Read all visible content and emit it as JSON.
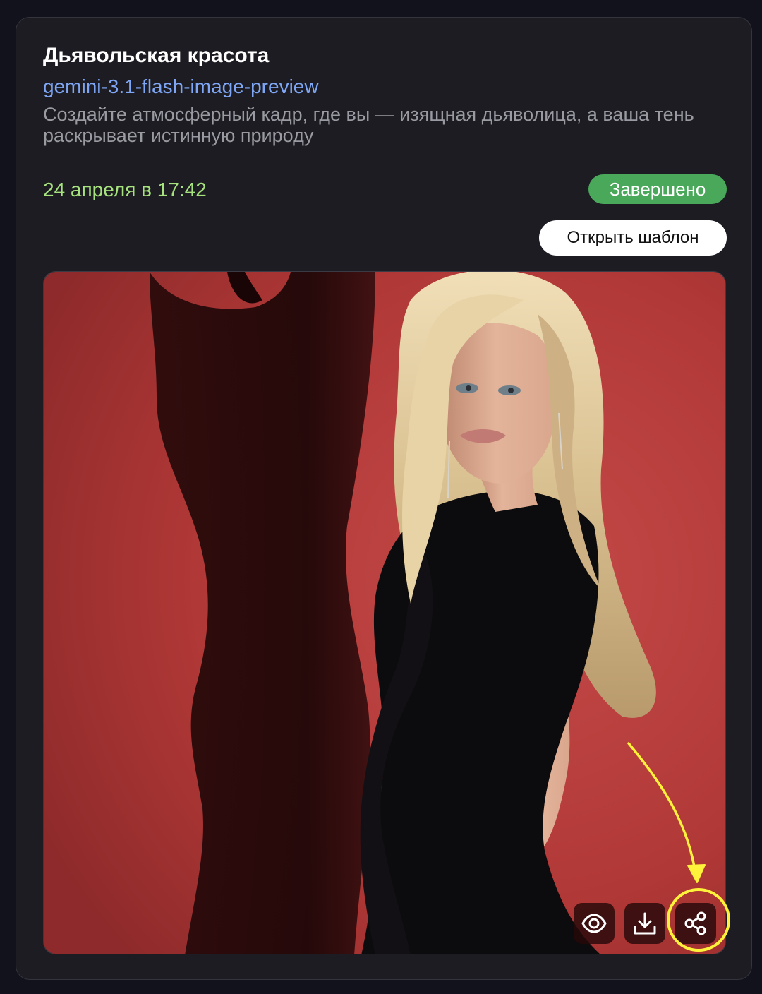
{
  "card": {
    "title": "Дьявольская красота",
    "model": "gemini-3.1-flash-image-preview",
    "description": "Создайте атмосферный кадр, где вы — изящная дьяволица, а ваша тень раскрывает истинную природу",
    "date": "24 апреля в 17:42",
    "status": "Завершено",
    "open_template_label": "Открыть шаблон"
  },
  "image": {
    "subject": "generated-portrait"
  },
  "actions": [
    {
      "name": "view",
      "icon": "eye-icon"
    },
    {
      "name": "download",
      "icon": "download-icon"
    },
    {
      "name": "share",
      "icon": "share-icon",
      "highlighted": true
    }
  ],
  "colors": {
    "page_background": "#12121c",
    "card_background": "#1c1c22",
    "link": "#7ea6f5",
    "date": "#a6e37e",
    "status_badge": "#4aa85a",
    "annotation": "#fff23a",
    "photo_background": "#b23a3a"
  }
}
